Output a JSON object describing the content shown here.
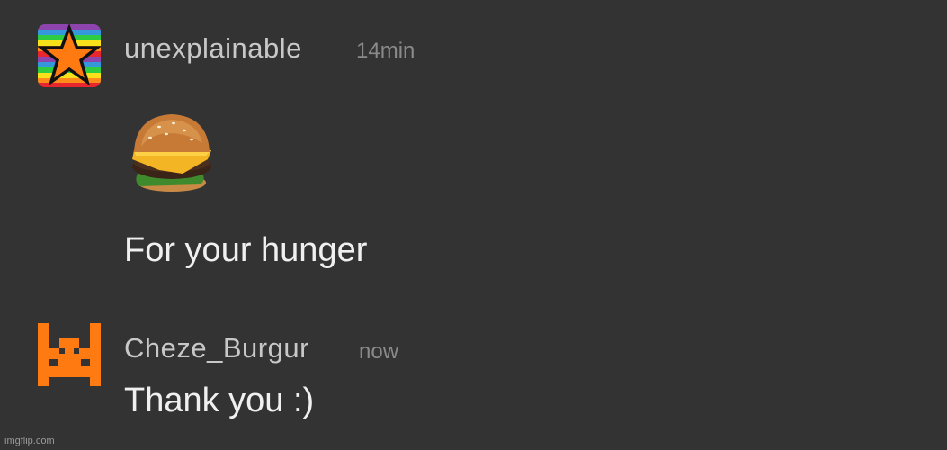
{
  "messages": [
    {
      "username": "unexplainable",
      "timestamp": "14min",
      "avatar_icon": "rainbow-star-icon",
      "sticker_icon": "cheeseburger-icon",
      "text": "For your hunger"
    },
    {
      "username": "Cheze_Burgur",
      "timestamp": "now",
      "avatar_icon": "pixel-creature-icon",
      "text": "Thank you :)"
    }
  ],
  "watermark": "imgflip.com",
  "colors": {
    "background": "#333333",
    "username": "#c8c8c8",
    "timestamp": "#8a8a8a",
    "message": "#f0f0f0",
    "avatar_orange": "#ff7a10"
  }
}
